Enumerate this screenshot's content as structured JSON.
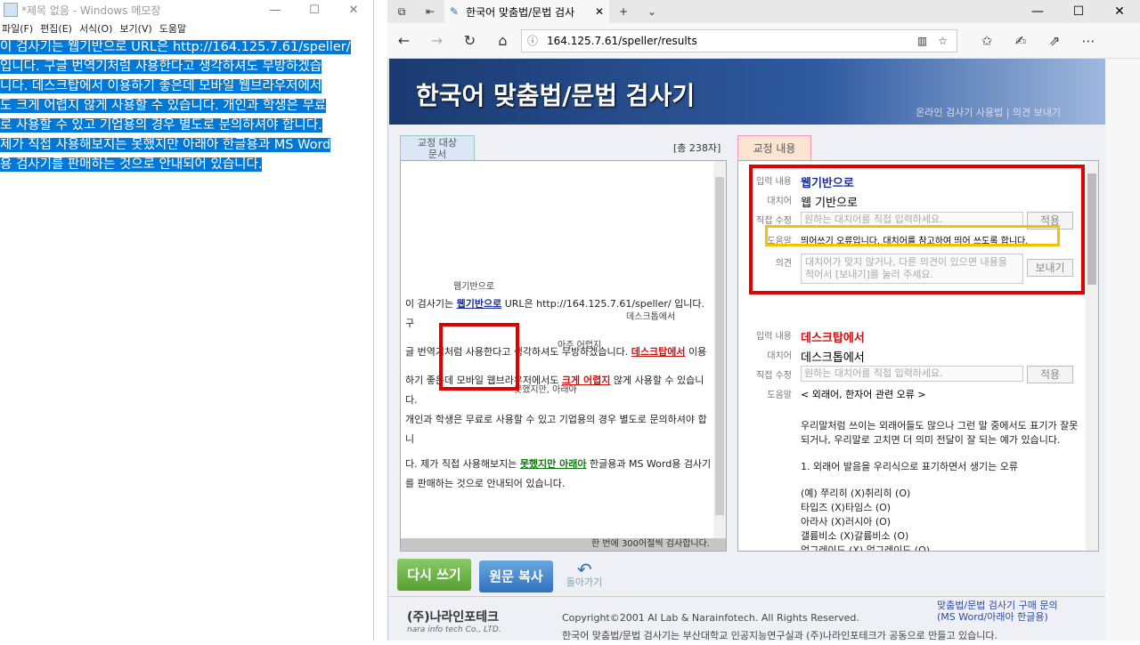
{
  "notepad": {
    "title": "*제목 없음 - Windows 메모장",
    "menu": [
      "파일(F)",
      "편집(E)",
      "서식(O)",
      "보기(V)",
      "도움말"
    ],
    "lines": [
      "이 검사기는 웹기반으로 URL은 http://164.125.7.61/speller/",
      "입니다. 구글 번역기처럼 사용한다고 생각하셔도 무방하겠습",
      "니다. 데스크탑에서 이용하기 좋은데 모바일 웹브라우저에서",
      "도 크게 어렵지 않게 사용할 수 있습니다. 개인과 학생은 무료",
      "로 사용할 수 있고 기업용의 경우 별도로 문의하셔야 합니다.",
      "제가 직접 사용해보지는 못했지만 아래아 한글용과 MS Word",
      "용 검사기를 판매하는 것으로 안내되어 있습니다."
    ]
  },
  "browser": {
    "tab_title": "한국어 맞춤법/문법 검사",
    "url": "164.125.7.61/speller/results"
  },
  "page": {
    "banner_title": "한국어 맞춤법/문법 검사기",
    "banner_links": "온라인 검사기 사용법  |  의견 보내기",
    "left_tab": "교정 대상\n문서",
    "total": "[총 238자]",
    "left_foot": "한 번에 300어절씩 검사합니다.",
    "right_tab": "교정 내용",
    "sugg1": "웹기반으로",
    "sugg2": "데스크톱에서",
    "sugg3": "아주 어렵지",
    "sugg4": "못했지만, 아래아",
    "text": {
      "l1a": "이 검사기는 ",
      "l1err": "웹기반으로",
      "l1b": " URL은 http://164.125.7.61/speller/ 입니다. 구",
      "l2a": "글 번역기처럼 사용한다고 생각하셔도 무방하겠습니다. ",
      "l2err": "데스크탑에서",
      "l2b": " 이용",
      "l3a": "하기 좋은데 모바일 웹브라우저에서도 ",
      "l3err": "크게 어렵지",
      "l3b": " 않게 사용할 수 있습니다.",
      "l4": "개인과 학생은 무료로 사용할 수 있고 기업용의 경우 별도로 문의하셔야 합니",
      "l5a": "다. 제가 직접 사용해보지는 ",
      "l5err": "못했지만 아래아",
      "l5b": " 한글용과 MS Word용 검사기",
      "l6": "를 판매하는 것으로 안내되어 있습니다."
    },
    "item1": {
      "k_input": "입력 내용",
      "input": "웹기반으로",
      "k_repl": "대치어",
      "repl": "웹 기반으로",
      "k_edit": "직접 수정",
      "edit_ph": "원하는 대치어를 직접 입력하세요.",
      "apply": "적용",
      "k_help": "도움말",
      "help": "띄어쓰기 오류입니다. 대치어를 참고하여 띄어 쓰도록 합니다.",
      "k_opinion": "의견",
      "opinion_ph": "대치어가 맞지 않거나, 다른 의견이 있으면 내용을 적어서 [보내기]를 눌러 주세요.",
      "send": "보내기"
    },
    "item2": {
      "k_input": "입력 내용",
      "input": "데스크탑에서",
      "k_repl": "대치어",
      "repl": "데스크톱에서",
      "k_edit": "직접 수정",
      "edit_ph": "원하는 대치어를 직접 입력하세요.",
      "apply": "적용",
      "k_help": "도움말",
      "help_title": "< 외래어, 한자어 관련 오류 >",
      "help_lines": [
        "우리말처럼 쓰이는 외래어들도 많으나 그런 말 중에서도 표기가 잘못되거나, 우리말로 고치면 더 의미 전달이 잘 되는 예가 있습니다.",
        "1. 외래어 발음을 우리식으로 표기하면서 생기는 오류",
        "(예) 쭈리히 (X)취리히 (O)",
        "타입즈 (X)타임스 (O)",
        "아라사 (X)러시아 (O)",
        "갤륨비소 (X)갈륨비소 (O)",
        "업그레이드 (X) 업그레이드 (O)"
      ]
    },
    "btn_rewrite": "다시 쓰기",
    "btn_copy": "원문 복사",
    "btn_back": "돌아가기",
    "footer": {
      "logo": "(주)나라인포테크",
      "logo_sub": "nara info tech Co., LTD.",
      "copy1": "Copyright©2001 AI Lab & Narainfotech. All Rights Reserved.",
      "copy2": "한국어 맞춤법/문법 검사기는 부산대학교 인공지능연구실과 (주)나라인포테크가 공동으로 만들고 있습니다.",
      "buy1": "맞춤법/문법 검사기 구매 문의",
      "buy2": "(MS Word/아래아 한글용)"
    }
  }
}
